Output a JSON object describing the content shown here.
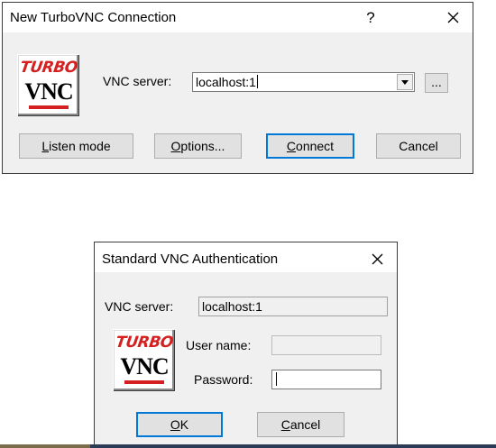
{
  "new_connection": {
    "title": "New TurboVNC Connection",
    "help_glyph": "?",
    "close_glyph": "×",
    "logo": {
      "line1": "TURBO",
      "line2": "VNC"
    },
    "server_label": "VNC server:",
    "server_value": "localhost:1",
    "browse_label": "...",
    "buttons": {
      "listen": {
        "accel": "L",
        "rest": "isten mode"
      },
      "options": {
        "accel": "O",
        "rest": "ptions..."
      },
      "connect": {
        "accel": "C",
        "rest": "onnect"
      },
      "cancel": "Cancel"
    }
  },
  "auth": {
    "title": "Standard VNC Authentication",
    "close_glyph": "×",
    "logo": {
      "line1": "TURBO",
      "line2": "VNC"
    },
    "server_label": "VNC server:",
    "server_value": "localhost:1",
    "username_label": "User name:",
    "username_value": "",
    "password_label": "Password:",
    "password_value": "",
    "buttons": {
      "ok": {
        "accel": "O",
        "rest": "K"
      },
      "cancel": {
        "accel": "C",
        "rest": "ancel"
      }
    }
  },
  "colors": {
    "dialog_bg": "#f0f0f0",
    "logo_red": "#d42020",
    "default_button_border": "#0078d7"
  },
  "icons": [
    "help-icon",
    "close-icon",
    "dropdown-arrow-icon",
    "turbovnc-logo"
  ]
}
